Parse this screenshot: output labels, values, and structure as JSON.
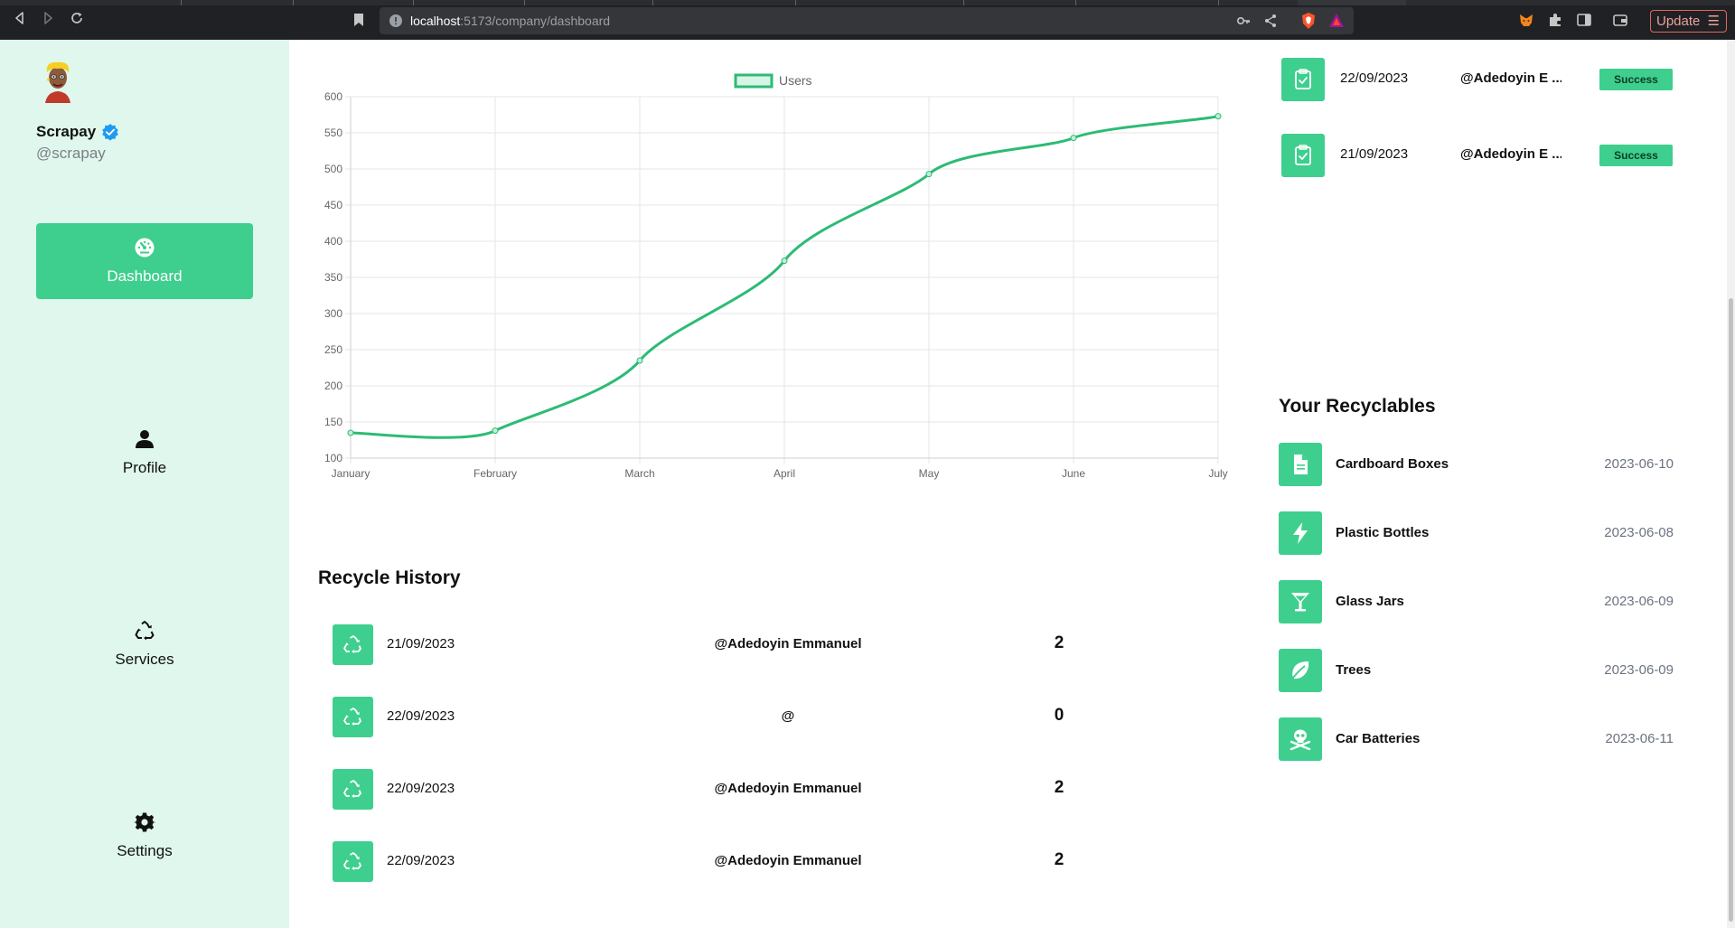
{
  "browser": {
    "url_host": "localhost",
    "url_path": ":5173/company/dashboard",
    "update_label": "Update",
    "menu_glyph": "☰"
  },
  "sidebar": {
    "brand_name": "Scrapay",
    "brand_handle": "@scrapay",
    "items": [
      {
        "label": "Dashboard",
        "icon": "dashboard-gauge-icon",
        "active": true
      },
      {
        "label": "Profile",
        "icon": "user-icon",
        "active": false
      },
      {
        "label": "Services",
        "icon": "recycle-icon",
        "active": false
      },
      {
        "label": "Settings",
        "icon": "gear-icon",
        "active": false
      }
    ]
  },
  "chart_data": {
    "type": "line",
    "categories": [
      "January",
      "February",
      "March",
      "April",
      "May",
      "June",
      "July"
    ],
    "series": [
      {
        "name": "Users",
        "values": [
          135,
          138,
          235,
          373,
          493,
          543,
          573
        ],
        "color": "#2dbb74"
      }
    ],
    "ylim": [
      100,
      600
    ],
    "yticks": [
      "100",
      "150",
      "200",
      "250",
      "300",
      "350",
      "400",
      "450",
      "500",
      "550",
      "600"
    ],
    "grid": true,
    "legend": "top-center"
  },
  "recycle_history": {
    "title": "Recycle History",
    "rows": [
      {
        "date": "21/09/2023",
        "user": "@Adedoyin Emmanuel",
        "count": "2"
      },
      {
        "date": "22/09/2023",
        "user": "@",
        "count": "0"
      },
      {
        "date": "22/09/2023",
        "user": "@Adedoyin Emmanuel",
        "count": "2"
      },
      {
        "date": "22/09/2023",
        "user": "@Adedoyin Emmanuel",
        "count": "2"
      }
    ]
  },
  "transactions": [
    {
      "date": "22/09/2023",
      "user": "@Adedoyin E ...",
      "status": "Success"
    },
    {
      "date": "21/09/2023",
      "user": "@Adedoyin E ...",
      "status": "Success"
    }
  ],
  "recyclables": {
    "title": "Your Recyclables",
    "items": [
      {
        "name": "Cardboard Boxes",
        "date": "2023-06-10",
        "icon": "document-icon"
      },
      {
        "name": "Plastic Bottles",
        "date": "2023-06-08",
        "icon": "lightning-icon"
      },
      {
        "name": "Glass Jars",
        "date": "2023-06-09",
        "icon": "cocktail-glass-icon"
      },
      {
        "name": "Trees",
        "date": "2023-06-09",
        "icon": "leaf-icon"
      },
      {
        "name": "Car Batteries",
        "date": "2023-06-11",
        "icon": "skull-crossbones-icon"
      }
    ]
  },
  "colors": {
    "accent": "#3ecf8e",
    "sidebar_bg": "#dff7ec",
    "line": "#2dbb74"
  }
}
